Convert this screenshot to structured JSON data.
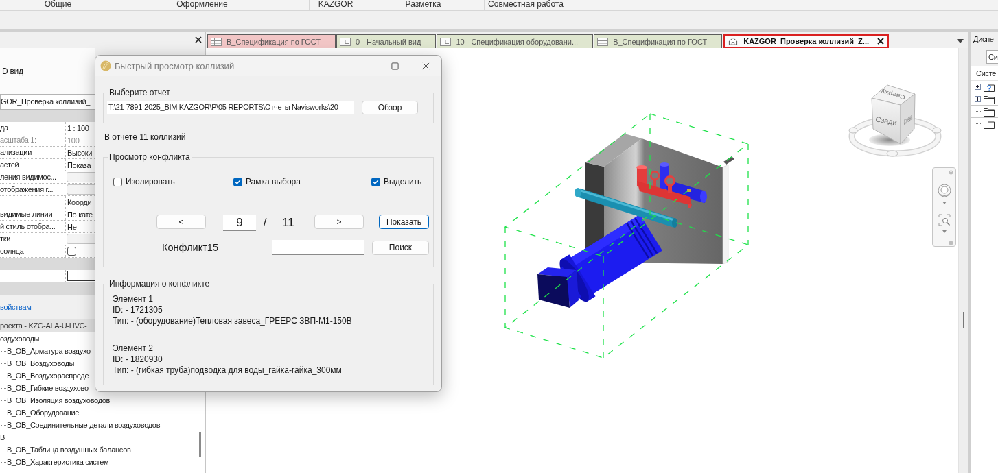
{
  "ribbon": {
    "panels": [
      "Общие",
      "Оформление",
      "KAZGOR",
      "Разметка",
      "Совместная работа"
    ]
  },
  "properties": {
    "type_name": "D вид",
    "instance_selector": "GOR_Проверка коллизий_",
    "rows": [
      {
        "kind": "group"
      },
      {
        "kind": "text",
        "label": "да",
        "value": "1 : 100",
        "disabled": false
      },
      {
        "kind": "text",
        "label": "асштаба 1:",
        "value": "100",
        "disabled": true
      },
      {
        "kind": "text",
        "label": "ализации",
        "value": "Высоки",
        "disabled": false
      },
      {
        "kind": "text",
        "label": "астей",
        "value": "Показа",
        "disabled": false
      },
      {
        "kind": "button",
        "label": "ления видимос...",
        "disabled": false
      },
      {
        "kind": "button",
        "label": "отображения г...",
        "disabled": false
      },
      {
        "kind": "text",
        "value": "Коорди",
        "disabled": false
      },
      {
        "kind": "text",
        "label": "видимые линии",
        "value": "По кате",
        "disabled": false
      },
      {
        "kind": "text",
        "label": "й стиль отобра...",
        "value": "Нет",
        "disabled": false
      },
      {
        "kind": "button",
        "label": "тки",
        "disabled": false
      },
      {
        "kind": "checkbox",
        "label": "солнца",
        "checked": false,
        "disabled": false
      },
      {
        "kind": "group"
      },
      {
        "kind": "edit"
      },
      {
        "kind": "group"
      }
    ],
    "link": "войствам"
  },
  "browser": {
    "title": "роекта - KZG-ALA-U-HVC-",
    "tree": [
      {
        "label": "оздуховоды",
        "children": [
          {
            "label": "В_ОВ_Арматура воздухо"
          },
          {
            "label": "В_ОВ_Воздуховоды"
          },
          {
            "label": "В_ОВ_Воздухораспреде"
          },
          {
            "label": "В_ОВ_Гибкие воздухово"
          },
          {
            "label": "В_ОВ_Изоляция воздуховодов"
          },
          {
            "label": "В_ОВ_Оборудование"
          },
          {
            "label": "В_ОВ_Соединительные детали воздуховодов"
          }
        ]
      },
      {
        "label": "В",
        "children": [
          {
            "label": "В_ОВ_Таблица воздушных балансов"
          },
          {
            "label": "В_ОВ_Характеристика систем"
          }
        ]
      }
    ]
  },
  "tabs": [
    {
      "label": "В_Спецификация по ГОСТ",
      "kind": "schedule",
      "selected": false,
      "color": "#f2c6c6"
    },
    {
      "label": "0 - Начальный вид",
      "kind": "view",
      "selected": false,
      "color": "#dfe6cf"
    },
    {
      "label": "10 - Спецификация оборудовани...",
      "kind": "view",
      "selected": false,
      "color": "#dfe6cf"
    },
    {
      "label": "В_Спецификация по ГОСТ",
      "kind": "schedule",
      "selected": false,
      "color": "#dfe6cf"
    },
    {
      "label": "KAZGOR_Проверка коллизий_Z...",
      "kind": "model",
      "selected": true
    }
  ],
  "view_cube": {
    "front": "Сзади",
    "right": "Слева",
    "top": "Сверху"
  },
  "system_browser": {
    "title": "Диспе",
    "selector": "Си",
    "label": "Систе",
    "items": [
      {
        "kind": "unknown",
        "expandable": true
      },
      {
        "kind": "folder",
        "expandable": true
      },
      {
        "kind": "folder",
        "expandable": false
      },
      {
        "kind": "folder",
        "expandable": false
      }
    ]
  },
  "dialog": {
    "title": "Быстрый просмотр коллизий",
    "report": {
      "legend": "Выберите отчет",
      "path": "T:\\21-7891-2025_BIM KAZGOR\\P\\05 REPORTS\\Отчеты Navisworks\\20",
      "browse": "Обзор"
    },
    "summary": "В отчете 11 коллизий",
    "viewer": {
      "legend": "Просмотр конфликта",
      "options": [
        {
          "label": "Изолировать",
          "checked": false
        },
        {
          "label": "Рамка выбора",
          "checked": true
        },
        {
          "label": "Выделить",
          "checked": true
        }
      ],
      "prev": "<",
      "current": "9",
      "separator": "/",
      "total": "11",
      "next": ">",
      "show": "Показать",
      "clash_name": "Конфликт15",
      "search": "Поиск"
    },
    "info": {
      "legend": "Информация о конфликте",
      "elements": [
        {
          "heading": "Элемент 1",
          "id": "ID: - 1721305",
          "type": "Тип: - (оборудование)Тепловая завеса_ГРЕЕРС ЗВП-М1-150В"
        },
        {
          "heading": "Элемент 2",
          "id": "ID: - 1820930",
          "type": "Тип: - (гибкая труба)подводка для воды_гайка-гайка_300мм"
        }
      ]
    }
  }
}
